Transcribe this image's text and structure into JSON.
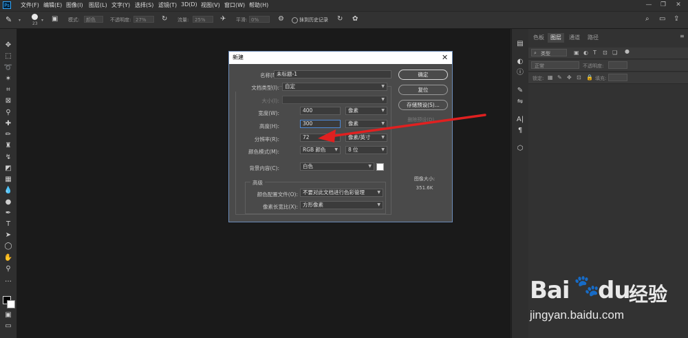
{
  "app": {
    "logo": "Ps"
  },
  "menus": [
    "文件(F)",
    "编辑(E)",
    "图像(I)",
    "图层(L)",
    "文字(Y)",
    "选择(S)",
    "滤镜(T)",
    "3D(D)",
    "视图(V)",
    "窗口(W)",
    "帮助(H)"
  ],
  "window_controls": {
    "minimize": "—",
    "restore": "❐",
    "close": "✕"
  },
  "options_bar": {
    "brush_size": "23",
    "mode_label": "模式:",
    "mode_value": "颜色",
    "opacity_label": "不透明度:",
    "opacity_value": "27%",
    "flow_label": "流量:",
    "flow_value": "25%",
    "smoothing_label": "平滑:",
    "smoothing_value": "0%",
    "erase_history_label": "抹到历史记录"
  },
  "panel": {
    "tabs": [
      "色板",
      "图层",
      "通道",
      "路径"
    ],
    "active_tab": "图层",
    "filter_kind": "类型",
    "blend_mode": "正常",
    "opacity_label": "不透明度:",
    "lock_label": "锁定:",
    "fill_label": "填充:"
  },
  "dialog": {
    "title": "新建",
    "close": "✕",
    "name_label": "名称(N):",
    "name_value": "未标题-1",
    "doctype_label": "文档类型(I):",
    "doctype_value": "自定",
    "size_label": "大小(I):",
    "size_value": "",
    "width_label": "宽度(W):",
    "width_value": "400",
    "width_unit": "像素",
    "height_label": "高度(H):",
    "height_value": "300",
    "height_unit": "像素",
    "resolution_label": "分辨率(R):",
    "resolution_value": "72",
    "resolution_unit": "像素/英寸",
    "colormode_label": "颜色模式(M):",
    "colormode_value": "RGB 颜色",
    "bitdepth_value": "8 位",
    "background_label": "背景内容(C):",
    "background_value": "白色",
    "advanced_label": "高级",
    "color_profile_label": "颜色配置文件(O):",
    "color_profile_value": "不要对此文档进行色彩管理",
    "pixel_aspect_label": "像素长宽比(X):",
    "pixel_aspect_value": "方形像素",
    "ok_label": "确定",
    "reset_label": "复位",
    "save_preset_label": "存储预设(S)...",
    "delete_preset_label": "删除预设(D)...",
    "image_size_label": "图像大小:",
    "image_size_value": "351.6K"
  },
  "annotation": {
    "arrow_color": "#e02020"
  },
  "watermark": {
    "brand_latin": "Bai",
    "brand_latin2": "du",
    "brand_cn": "经验",
    "url": "jingyan.baidu.com"
  }
}
